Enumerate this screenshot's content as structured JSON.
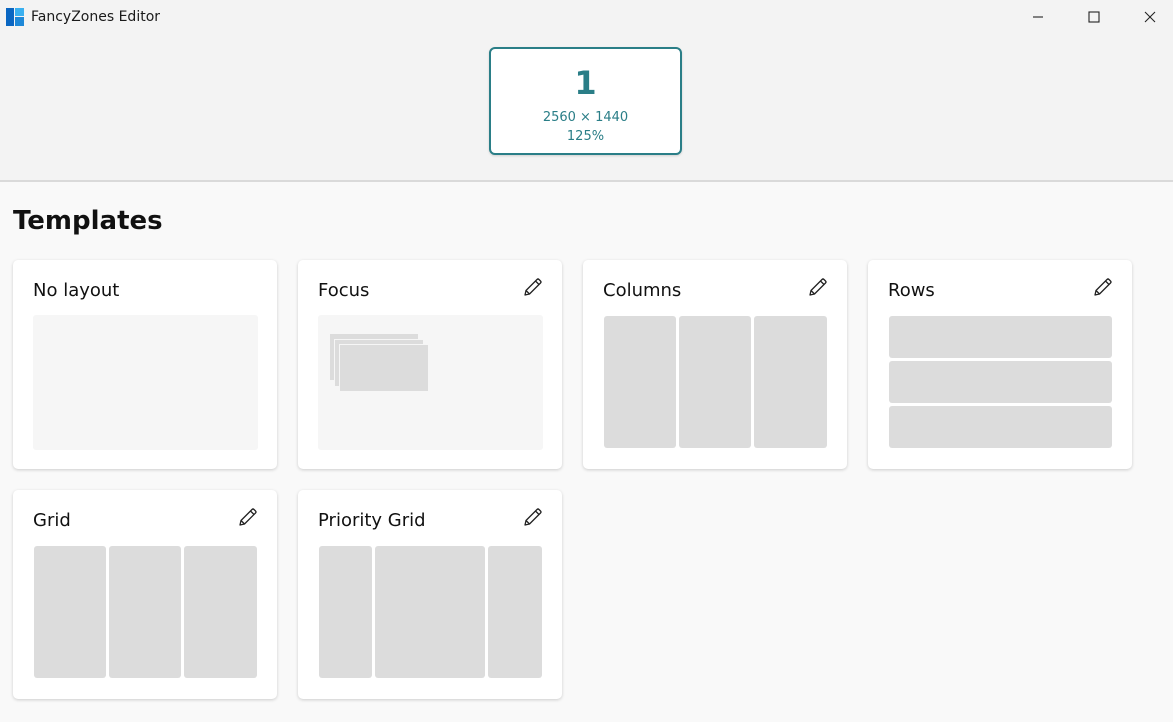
{
  "window": {
    "title": "FancyZones Editor"
  },
  "icons": {
    "app": "fancyzones-app-icon",
    "minimize": "minimize-icon",
    "maximize": "maximize-icon",
    "close": "close-icon",
    "edit": "pencil-icon"
  },
  "colors": {
    "accent": "#2a7e87",
    "zone": "#dcdcdc",
    "card_bg": "#ffffff",
    "page_bg": "#f9f9f9"
  },
  "monitor": {
    "number": "1",
    "resolution": "2560 × 1440",
    "scale": "125%"
  },
  "templates": {
    "section_title": "Templates",
    "items": [
      {
        "name": "No layout",
        "editable": false,
        "zone_type": "blank"
      },
      {
        "name": "Focus",
        "editable": true,
        "zone_type": "focus"
      },
      {
        "name": "Columns",
        "editable": true,
        "zone_type": "columns"
      },
      {
        "name": "Rows",
        "editable": true,
        "zone_type": "rows"
      },
      {
        "name": "Grid",
        "editable": true,
        "zone_type": "grid"
      },
      {
        "name": "Priority Grid",
        "editable": true,
        "zone_type": "priority-grid"
      }
    ]
  }
}
